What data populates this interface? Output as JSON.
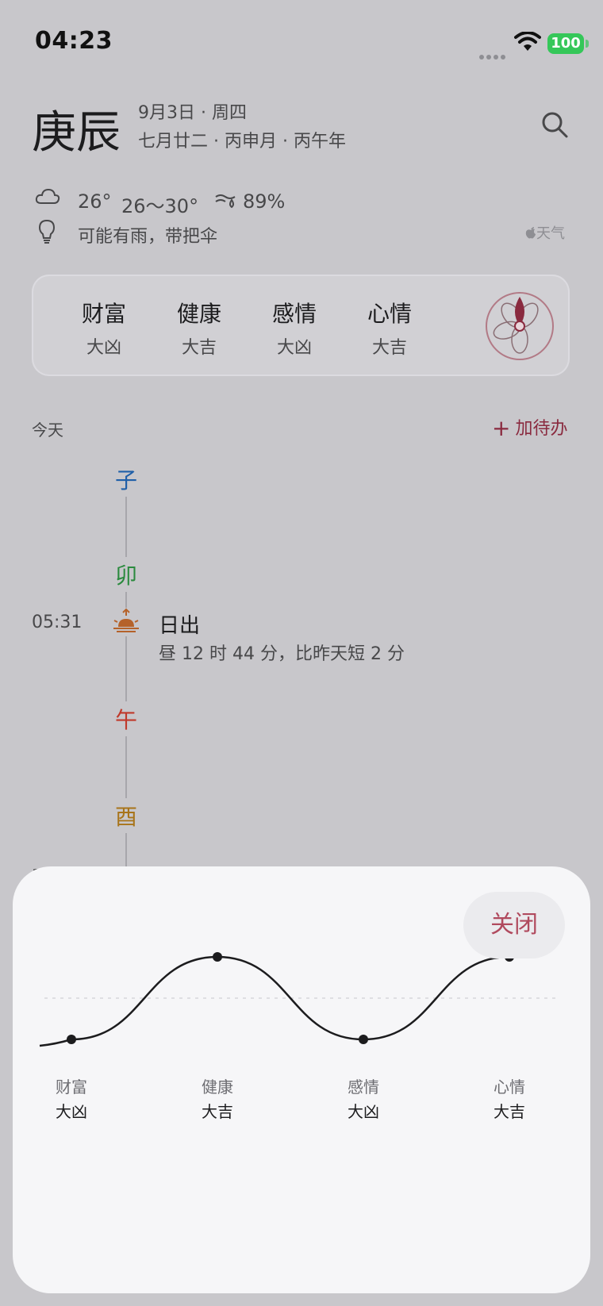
{
  "status_bar": {
    "time": "04:23",
    "battery": "100"
  },
  "header": {
    "day_ganzhi": "庚辰",
    "date_line": "9月3日 · 周四",
    "lunar_line": "七月廿二 · 丙申月 · 丙午年"
  },
  "weather": {
    "temp_now": "26°",
    "temp_range": "26～30°",
    "humidity": "89%",
    "tip": "可能有雨，带把伞",
    "brand": "天气"
  },
  "fortune": [
    {
      "title": "财富",
      "level": "大凶"
    },
    {
      "title": "健康",
      "level": "大吉"
    },
    {
      "title": "感情",
      "level": "大凶"
    },
    {
      "title": "心情",
      "level": "大吉"
    }
  ],
  "today": {
    "label": "今天",
    "add_todo": "加待办",
    "branches": {
      "zi": "子",
      "mao": "卯",
      "wu": "午",
      "you": "酉"
    },
    "sunrise": {
      "time": "05:31",
      "title": "日出",
      "detail": "昼 12 时 44 分，比昨天短 2 分"
    },
    "stub": "1"
  },
  "sheet": {
    "close_label": "关闭",
    "chart_data": {
      "type": "line",
      "categories": [
        "财富",
        "健康",
        "感情",
        "心情"
      ],
      "category_levels": [
        "大凶",
        "大吉",
        "大凶",
        "大吉"
      ],
      "values": [
        -1,
        1,
        -1,
        1
      ],
      "ylim": [
        -1.2,
        1.2
      ],
      "grid": "dashed midline"
    }
  },
  "colors": {
    "accent": "#8a2a3f",
    "close_text": "#b04a5e",
    "zi": "#1f5fa8",
    "mao": "#2b8a3e",
    "wu": "#c0392b",
    "you": "#a8741a",
    "sunrise_icon": "#b5622a"
  },
  "icons": [
    "wifi-icon",
    "search-icon",
    "cloud-icon",
    "humidity-icon",
    "bulb-icon",
    "apple-icon",
    "flower-icon",
    "plus-icon",
    "sunrise-icon"
  ]
}
